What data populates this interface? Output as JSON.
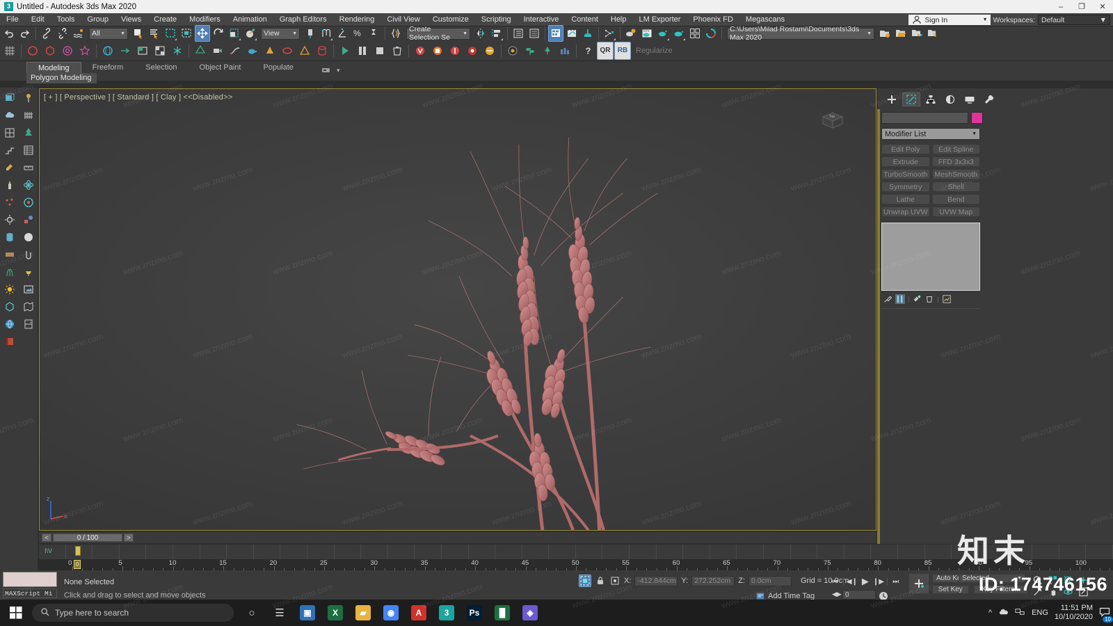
{
  "titlebar": {
    "title": "Untitled - Autodesk 3ds Max 2020",
    "app_icon": "3",
    "minimize": "–",
    "maximize": "❐",
    "close": "✕"
  },
  "menubar": {
    "items": [
      "File",
      "Edit",
      "Tools",
      "Group",
      "Views",
      "Create",
      "Modifiers",
      "Animation",
      "Graph Editors",
      "Rendering",
      "Civil View",
      "Customize",
      "Scripting",
      "Interactive",
      "Content",
      "Help",
      "LM Exporter",
      "Phoenix FD",
      "Megascans"
    ],
    "sign_in": "Sign In",
    "workspaces_label": "Workspaces:",
    "workspace_value": "Default"
  },
  "toolbar": {
    "selection_filter": "All",
    "reference_coord": "View",
    "selection_set": "Create Selection Se",
    "project_path": "C:\\Users\\Milad Rostami\\Documents\\3ds Max 2020",
    "regularize": "Regularize",
    "qr_label": "QR",
    "rb_label": "RB"
  },
  "ribbon": {
    "tabs": [
      "Modeling",
      "Freeform",
      "Selection",
      "Object Paint",
      "Populate"
    ],
    "selected_tab": "Modeling",
    "panel_label": "Polygon Modeling"
  },
  "viewport": {
    "label": "[ + ] [ Perspective ] [ Standard ] [ Clay ]  <<Disabled>>",
    "viewcube_label": "Top",
    "axis_z": "Z",
    "axis_x": "X",
    "background_color": "#3b3b3b",
    "border_color": "#9c8a3a",
    "object_color": "#c07c7c"
  },
  "command_panel": {
    "tabs": [
      "create-tab",
      "modify-tab",
      "hierarchy-tab",
      "motion-tab",
      "display-tab",
      "utilities-tab"
    ],
    "selected_tab_index": 1,
    "object_name": "",
    "object_color": "#e0349b",
    "modifier_list_label": "Modifier List",
    "modifier_buttons": [
      "Edit Poly",
      "Edit Spline",
      "Extrude",
      "FFD 3x3x3",
      "TurboSmooth",
      "MeshSmooth",
      "Symmetry",
      "Shell",
      "Lathe",
      "Bend",
      "Unwrap UVW",
      "UVW Map"
    ]
  },
  "timebar": {
    "prev_label": "<",
    "next_label": ">",
    "frame_display": "0 / 100",
    "ruler_ticks": [
      0,
      5,
      10,
      15,
      20,
      25,
      30,
      35,
      40,
      45,
      50,
      55,
      60,
      65,
      70,
      75,
      80,
      85,
      90,
      95,
      100
    ],
    "cursor_frame": "0",
    "trackbar_tag": "I\\V"
  },
  "statusbar": {
    "maxscript_label": "MAXScript Mi",
    "selection_status": "None Selected",
    "prompt": "Click and drag to select and move objects",
    "x_label": "X:",
    "x_value": "-412.844cm",
    "y_label": "Y:",
    "y_value": "272.252cm",
    "z_label": "Z:",
    "z_value": "0.0cm",
    "grid": "Grid = 10.0cm",
    "add_time_tag": "Add Time Tag",
    "auto_key": "Auto Key",
    "set_key": "Set Key",
    "key_mode": "Selected",
    "key_filters": "Key Filters...",
    "frame_spinner": "0"
  },
  "taskbar": {
    "search_placeholder": "Type here to search",
    "apps": [
      {
        "name": "cortana-icon",
        "glyph": "○",
        "color": "transparent"
      },
      {
        "name": "task-view-icon",
        "glyph": "☰",
        "color": "transparent"
      },
      {
        "name": "app-icon-blue",
        "glyph": "▣",
        "color": "#2e72b8"
      },
      {
        "name": "app-icon-excel",
        "glyph": "X",
        "color": "#1d6f42"
      },
      {
        "name": "file-explorer-icon",
        "glyph": "▰",
        "color": "#e8b341"
      },
      {
        "name": "chrome-icon",
        "glyph": "◉",
        "color": "#4285f4"
      },
      {
        "name": "autodesk-icon",
        "glyph": "A",
        "color": "#d0322c"
      },
      {
        "name": "3dsmax-icon",
        "glyph": "3",
        "color": "#19a6a0"
      },
      {
        "name": "photoshop-icon",
        "glyph": "Ps",
        "color": "#001e36"
      },
      {
        "name": "excel2-icon",
        "glyph": "█",
        "color": "#1d6f42"
      },
      {
        "name": "misc-icon",
        "glyph": "◈",
        "color": "#6b5bd2"
      }
    ],
    "language": "ENG",
    "time": "11:51 PM",
    "date": "10/10/2020",
    "notification_count": "10"
  },
  "overlay": {
    "id_text": "ID: 174746156",
    "watermark_text": "www.znzmo.com",
    "watermark_cn": "知末"
  }
}
